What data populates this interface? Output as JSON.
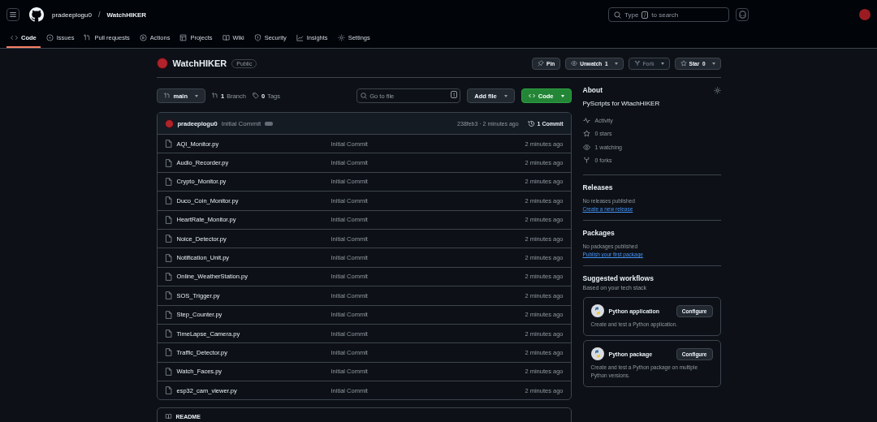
{
  "header": {
    "owner": "pradeeplogu0",
    "separator": "/",
    "repo": "WatchHIKER",
    "search_placeholder": "Type",
    "search_key": "/",
    "search_suffix": "to search"
  },
  "nav_tabs": [
    {
      "label": "Code",
      "selected": true
    },
    {
      "label": "Issues",
      "selected": false
    },
    {
      "label": "Pull requests",
      "selected": false
    },
    {
      "label": "Actions",
      "selected": false
    },
    {
      "label": "Projects",
      "selected": false
    },
    {
      "label": "Wiki",
      "selected": false
    },
    {
      "label": "Security",
      "selected": false
    },
    {
      "label": "Insights",
      "selected": false
    },
    {
      "label": "Settings",
      "selected": false
    }
  ],
  "repo": {
    "name": "WatchHIKER",
    "visibility": "Public",
    "actions": [
      {
        "label": "Pin",
        "disabled": false
      },
      {
        "label": "Unwatch",
        "count": "1",
        "disabled": false
      },
      {
        "label": "Fork",
        "disabled": true
      },
      {
        "label": "Star",
        "count": "0",
        "disabled": false
      }
    ]
  },
  "toolbar": {
    "branch": "main",
    "branches_count": "1",
    "branches_label": "Branch",
    "tags_count": "0",
    "tags_label": "Tags",
    "go_to_file_placeholder": "Go to file",
    "go_to_file_key": "t",
    "add_file": "Add file",
    "code": "Code"
  },
  "latest_commit": {
    "author": "pradeeplogu0",
    "message": "Initial Commit",
    "hash_time": "238feb3 · 2 minutes ago",
    "commits": "1 Commit"
  },
  "files": [
    {
      "name": "AQI_Monitor.py",
      "commit": "Initial Commit",
      "time": "2 minutes ago"
    },
    {
      "name": "Audio_Recorder.py",
      "commit": "Initial Commit",
      "time": "2 minutes ago"
    },
    {
      "name": "Crypto_Monitor.py",
      "commit": "Initial Commit",
      "time": "2 minutes ago"
    },
    {
      "name": "Duco_Coin_Monitor.py",
      "commit": "Initial Commit",
      "time": "2 minutes ago"
    },
    {
      "name": "HeartRate_Monitor.py",
      "commit": "Initial Commit",
      "time": "2 minutes ago"
    },
    {
      "name": "Noice_Detector.py",
      "commit": "Initial Commit",
      "time": "2 minutes ago"
    },
    {
      "name": "Notification_Unit.py",
      "commit": "Initial Commit",
      "time": "2 minutes ago"
    },
    {
      "name": "Online_WeatherStation.py",
      "commit": "Initial Commit",
      "time": "2 minutes ago"
    },
    {
      "name": "SOS_Trigger.py",
      "commit": "Initial Commit",
      "time": "2 minutes ago"
    },
    {
      "name": "Step_Counter.py",
      "commit": "Initial Commit",
      "time": "2 minutes ago"
    },
    {
      "name": "TimeLapse_Camera.py",
      "commit": "Initial Commit",
      "time": "2 minutes ago"
    },
    {
      "name": "Traffic_Detector.py",
      "commit": "Initial Commit",
      "time": "2 minutes ago"
    },
    {
      "name": "Watch_Faces.py",
      "commit": "Initial Commit",
      "time": "2 minutes ago"
    },
    {
      "name": "esp32_cam_viewer.py",
      "commit": "Initial Commit",
      "time": "2 minutes ago"
    }
  ],
  "readme": {
    "label": "README"
  },
  "about": {
    "title": "About",
    "description": "PyScripts for WtachHIKER",
    "stats": [
      {
        "label": "Activity"
      },
      {
        "label": "0 stars"
      },
      {
        "label": "1 watching"
      },
      {
        "label": "0 forks"
      }
    ]
  },
  "releases": {
    "title": "Releases",
    "text": "No releases published",
    "link": "Create a new release"
  },
  "packages": {
    "title": "Packages",
    "text": "No packages published",
    "link": "Publish your first package"
  },
  "workflows": {
    "title": "Suggested workflows",
    "subtitle": "Based on your tech stack",
    "items": [
      {
        "name": "Python application",
        "button": "Configure",
        "description": "Create and test a Python application."
      },
      {
        "name": "Python package",
        "button": "Configure",
        "description": "Create and test a Python package on multiple Python versions."
      }
    ]
  }
}
